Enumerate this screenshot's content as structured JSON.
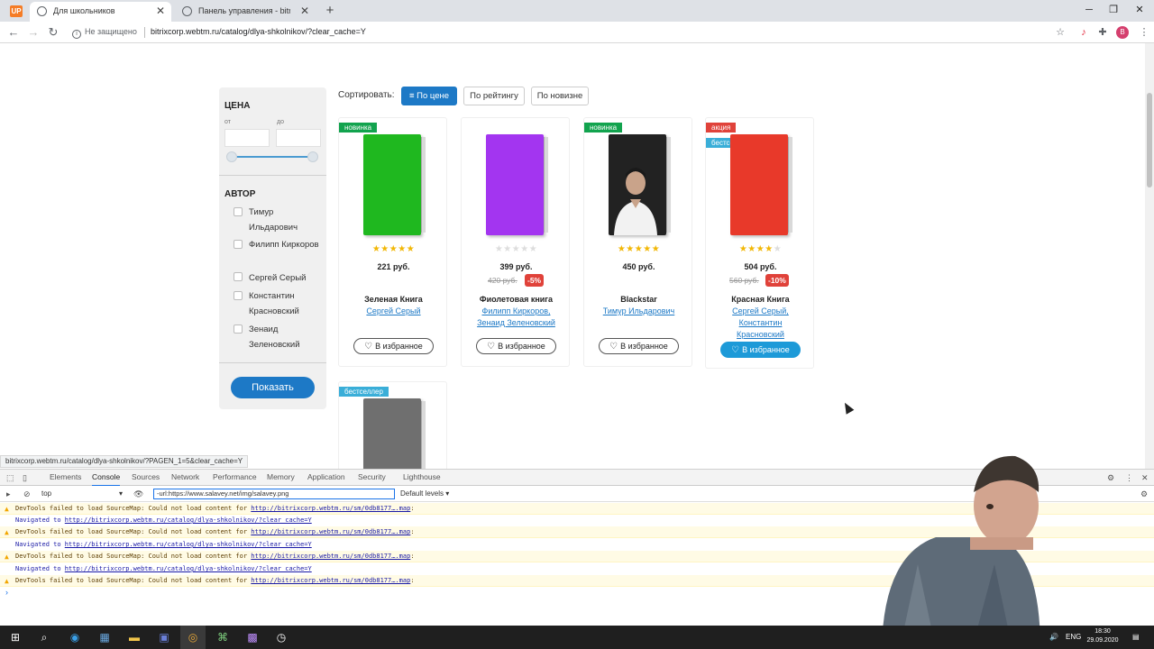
{
  "browser": {
    "app_logo": "UP",
    "tabs": [
      {
        "title": "Для школьников",
        "active": true
      },
      {
        "title": "Панель управления - bitrixcorp",
        "active": false
      }
    ],
    "new_tab_label": "+",
    "security_label": "Не защищено",
    "url": "bitrixcorp.webtm.ru/catalog/dlya-shkolnikov/?clear_cache=Y",
    "profile_initial": "B",
    "status_url": "bitrixcorp.webtm.ru/catalog/dlya-shkolnikov/?PAGEN_1=5&clear_cache=Y"
  },
  "filter": {
    "price_heading": "ЦЕНА",
    "from_label": "от",
    "to_label": "до",
    "author_heading": "АВТОР",
    "authors": [
      "Тимур Ильдарович",
      "Филипп Киркоров",
      "Сергей Серый",
      "Константин Красновский",
      "Зенаид Зеленовский"
    ],
    "show_button": "Показать"
  },
  "sort": {
    "label": "Сортировать:",
    "options": [
      {
        "label": "По цене",
        "active": true
      },
      {
        "label": "По рейтингу",
        "active": false
      },
      {
        "label": "По новизне",
        "active": false
      }
    ]
  },
  "products": [
    {
      "badges": [
        "новинка"
      ],
      "cover_color": "#1fb81f",
      "rating": 5,
      "price": "221 руб.",
      "old_price": "",
      "discount": "",
      "title": "Зеленая Книга",
      "authors": [
        "Сергей Серый"
      ],
      "fav_label": "В избранное",
      "fav_active": false
    },
    {
      "badges": [],
      "cover_color": "#a335f0",
      "rating": 0,
      "price": "399 руб.",
      "old_price": "420 руб.",
      "discount": "-5%",
      "title": "Фиолетовая книга",
      "authors": [
        "Филипп Киркоров,",
        "Зенаид Зеленовский"
      ],
      "fav_label": "В избранное",
      "fav_active": false
    },
    {
      "badges": [
        "новинка"
      ],
      "cover_color": "#222222",
      "rating": 5,
      "price": "450 руб.",
      "old_price": "",
      "discount": "",
      "title": "Blackstar",
      "authors": [
        "Тимур Ильдарович"
      ],
      "fav_label": "В избранное",
      "fav_active": false
    },
    {
      "badges": [
        "акция",
        "бестселлер"
      ],
      "cover_color": "#e8392a",
      "rating": 4,
      "price": "504 руб.",
      "old_price": "560 руб.",
      "discount": "-10%",
      "title": "Красная Книга",
      "authors": [
        "Сергей Серый,",
        "Константин",
        "Красновский"
      ],
      "fav_label": "В избранное",
      "fav_active": true
    },
    {
      "badges": [
        "бестселлер"
      ],
      "cover_color": "#6f6f6f",
      "rating": 0,
      "price": "",
      "old_price": "",
      "discount": "",
      "title": "",
      "authors": [],
      "fav_label": "",
      "fav_active": false
    }
  ],
  "devtools": {
    "tabs": [
      "Elements",
      "Console",
      "Sources",
      "Network",
      "Performance",
      "Memory",
      "Application",
      "Security",
      "Lighthouse"
    ],
    "active_tab": "Console",
    "context": "top",
    "filter_value": "-url:https://www.salavey.net/img/salavey.png",
    "levels": "Default levels ▾",
    "lines": [
      {
        "type": "warn",
        "text": "DevTools failed to load SourceMap: Could not load content for ",
        "link": "http://bitrixcorp.webtm.ru/sm/0db8177….map",
        "suffix": ":"
      },
      {
        "type": "nav",
        "text": "Navigated to ",
        "link": "http://bitrixcorp.webtm.ru/catalog/dlya-shkolnikov/?clear_cache=Y",
        "suffix": ""
      },
      {
        "type": "warn",
        "text": "DevTools failed to load SourceMap: Could not load content for ",
        "link": "http://bitrixcorp.webtm.ru/sm/0db8177….map",
        "suffix": ":"
      },
      {
        "type": "nav",
        "text": "Navigated to ",
        "link": "http://bitrixcorp.webtm.ru/catalog/dlya-shkolnikov/?clear_cache=Y",
        "suffix": ""
      },
      {
        "type": "warn",
        "text": "DevTools failed to load SourceMap: Could not load content for ",
        "link": "http://bitrixcorp.webtm.ru/sm/0db8177….map",
        "suffix": ":"
      },
      {
        "type": "nav",
        "text": "Navigated to ",
        "link": "http://bitrixcorp.webtm.ru/catalog/dlya-shkolnikov/?clear_cache=Y",
        "suffix": ""
      },
      {
        "type": "warn",
        "text": "DevTools failed to load SourceMap: Could not load content for ",
        "link": "http://bitrixcorp.webtm.ru/sm/0db8177….map",
        "suffix": ":"
      }
    ]
  },
  "taskbar": {
    "lang": "ENG",
    "time": "18:30",
    "date": "29.09.2020"
  }
}
